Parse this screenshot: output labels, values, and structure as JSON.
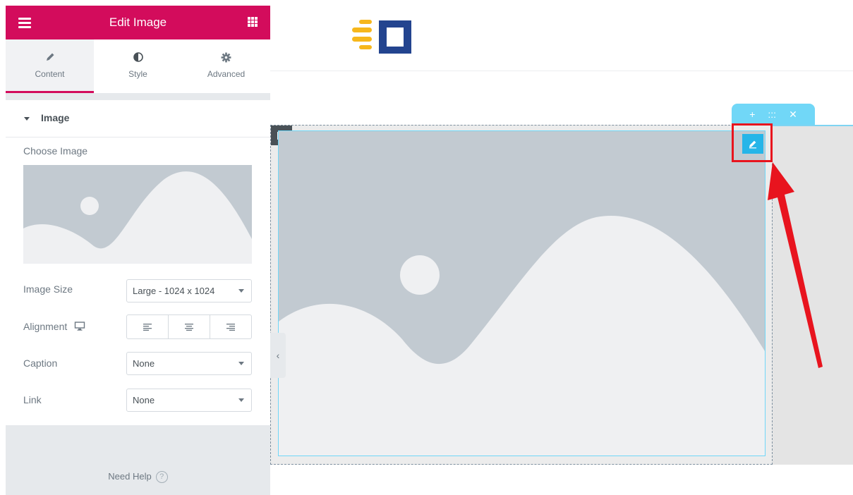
{
  "panel": {
    "title": "Edit Image",
    "tabs": [
      {
        "label": "Content",
        "icon": "pencil-icon"
      },
      {
        "label": "Style",
        "icon": "half-circle-icon"
      },
      {
        "label": "Advanced",
        "icon": "gear-icon"
      }
    ],
    "section_title": "Image",
    "choose_image_label": "Choose Image",
    "image_size": {
      "label": "Image Size",
      "value": "Large - 1024 x 1024"
    },
    "alignment": {
      "label": "Alignment",
      "options": [
        "left",
        "center",
        "right"
      ]
    },
    "caption": {
      "label": "Caption",
      "value": "None"
    },
    "link": {
      "label": "Link",
      "value": "None"
    },
    "need_help": "Need Help",
    "help_icon_text": "?"
  },
  "colors": {
    "accent": "#d30c5c",
    "selection": "#71d7f7",
    "edit_button": "#26b5e8",
    "highlight": "#e8141e",
    "placeholder_bg": "#c2cad1",
    "placeholder_fg": "#eff0f2"
  },
  "canvas": {
    "section_toolbar": [
      "+",
      ":::",
      "✕"
    ],
    "collapse_label": "‹"
  }
}
